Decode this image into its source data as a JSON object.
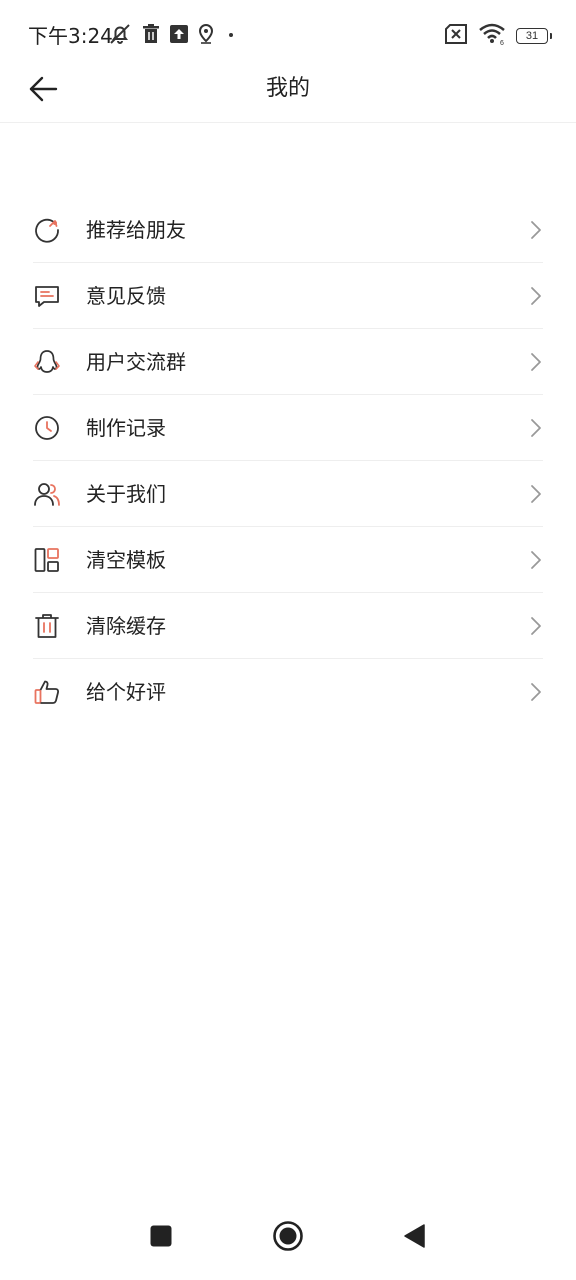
{
  "status_bar": {
    "time": "下午3:24",
    "battery": "31",
    "icons_left": [
      "notifications-muted-icon",
      "trash-icon",
      "upload-icon",
      "location-icon",
      "dot-icon"
    ],
    "icons_right": [
      "sim-missing-icon",
      "wifi-icon",
      "battery-icon"
    ]
  },
  "header": {
    "title": "我的",
    "back_icon": "arrow-left-icon"
  },
  "menu": {
    "items": [
      {
        "label": "推荐给朋友",
        "icon": "share-refresh-icon"
      },
      {
        "label": "意见反馈",
        "icon": "feedback-message-icon"
      },
      {
        "label": "用户交流群",
        "icon": "qq-penguin-icon"
      },
      {
        "label": "制作记录",
        "icon": "clock-icon"
      },
      {
        "label": "关于我们",
        "icon": "users-icon"
      },
      {
        "label": "清空模板",
        "icon": "template-layout-icon"
      },
      {
        "label": "清除缓存",
        "icon": "trash-icon"
      },
      {
        "label": "给个好评",
        "icon": "thumbs-up-icon"
      }
    ],
    "chevron_icon": "chevron-right-icon"
  },
  "colors": {
    "accent": "#e8735f",
    "text": "#222222",
    "divider": "#eeeeee",
    "chevron": "#999999"
  },
  "nav_bar": {
    "buttons": [
      "recents-square-icon",
      "home-circle-icon",
      "back-triangle-icon"
    ]
  }
}
